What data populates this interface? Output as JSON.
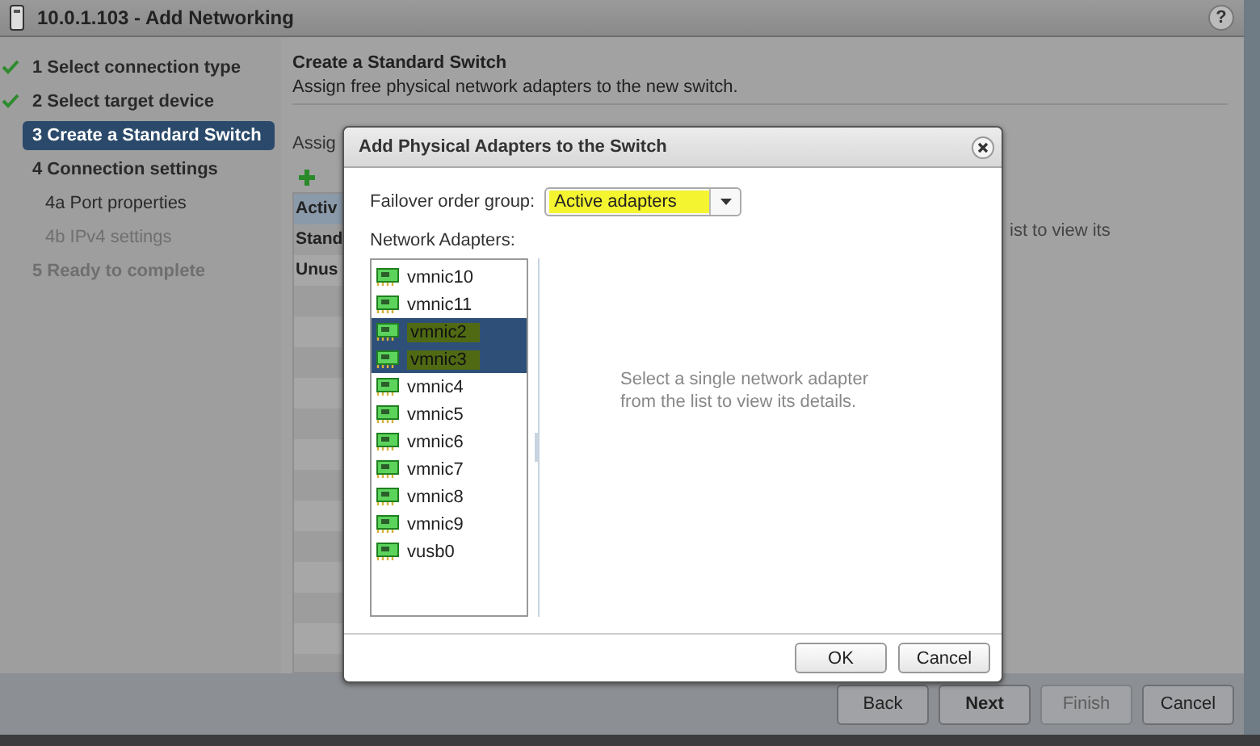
{
  "window": {
    "title": "10.0.1.103 - Add Networking",
    "help": "?"
  },
  "steps": [
    {
      "number": "1",
      "label": "Select connection type",
      "completed": true,
      "selected": false,
      "disabled": false
    },
    {
      "number": "2",
      "label": "Select target device",
      "completed": true,
      "selected": false,
      "disabled": false
    },
    {
      "number": "3",
      "label": "Create a Standard Switch",
      "completed": false,
      "selected": true,
      "disabled": false
    },
    {
      "number": "4",
      "label": "Connection settings",
      "completed": false,
      "selected": false,
      "disabled": false,
      "children": [
        {
          "number": "4a",
          "label": "Port properties",
          "completed": false,
          "selected": false,
          "disabled": false
        },
        {
          "number": "4b",
          "label": "IPv4 settings",
          "completed": false,
          "selected": false,
          "disabled": true
        }
      ]
    },
    {
      "number": "5",
      "label": "Ready to complete",
      "completed": false,
      "selected": false,
      "disabled": true
    }
  ],
  "page": {
    "title": "Create a Standard Switch",
    "subtitle": "Assign free physical network adapters to the new switch.",
    "assign_label": "Assig",
    "groups": [
      {
        "label": "Activ",
        "selected": true
      },
      {
        "label": "Stand",
        "selected": false
      },
      {
        "label": "Unus",
        "selected": false
      }
    ],
    "detail_hint": "ist to view its"
  },
  "footer_buttons": [
    {
      "label": "Back",
      "disabled": false
    },
    {
      "label": "Next",
      "disabled": false
    },
    {
      "label": "Finish",
      "disabled": true
    },
    {
      "label": "Cancel",
      "disabled": false
    }
  ],
  "dialog": {
    "title": "Add Physical Adapters to the Switch",
    "failover_label": "Failover order group:",
    "failover_value": "Active adapters",
    "failover_highlighted": true,
    "adapters_label": "Network Adapters:",
    "adapters": [
      {
        "name": "vmnic10",
        "selected": false
      },
      {
        "name": "vmnic11",
        "selected": false
      },
      {
        "name": "vmnic2",
        "selected": true
      },
      {
        "name": "vmnic3",
        "selected": true
      },
      {
        "name": "vmnic4",
        "selected": false
      },
      {
        "name": "vmnic5",
        "selected": false
      },
      {
        "name": "vmnic6",
        "selected": false
      },
      {
        "name": "vmnic7",
        "selected": false
      },
      {
        "name": "vmnic8",
        "selected": false
      },
      {
        "name": "vmnic9",
        "selected": false
      },
      {
        "name": "vusb0",
        "selected": false
      }
    ],
    "detail_hint": "Select a single network adapter from the list to view its details.",
    "buttons": [
      "OK",
      "Cancel"
    ]
  }
}
